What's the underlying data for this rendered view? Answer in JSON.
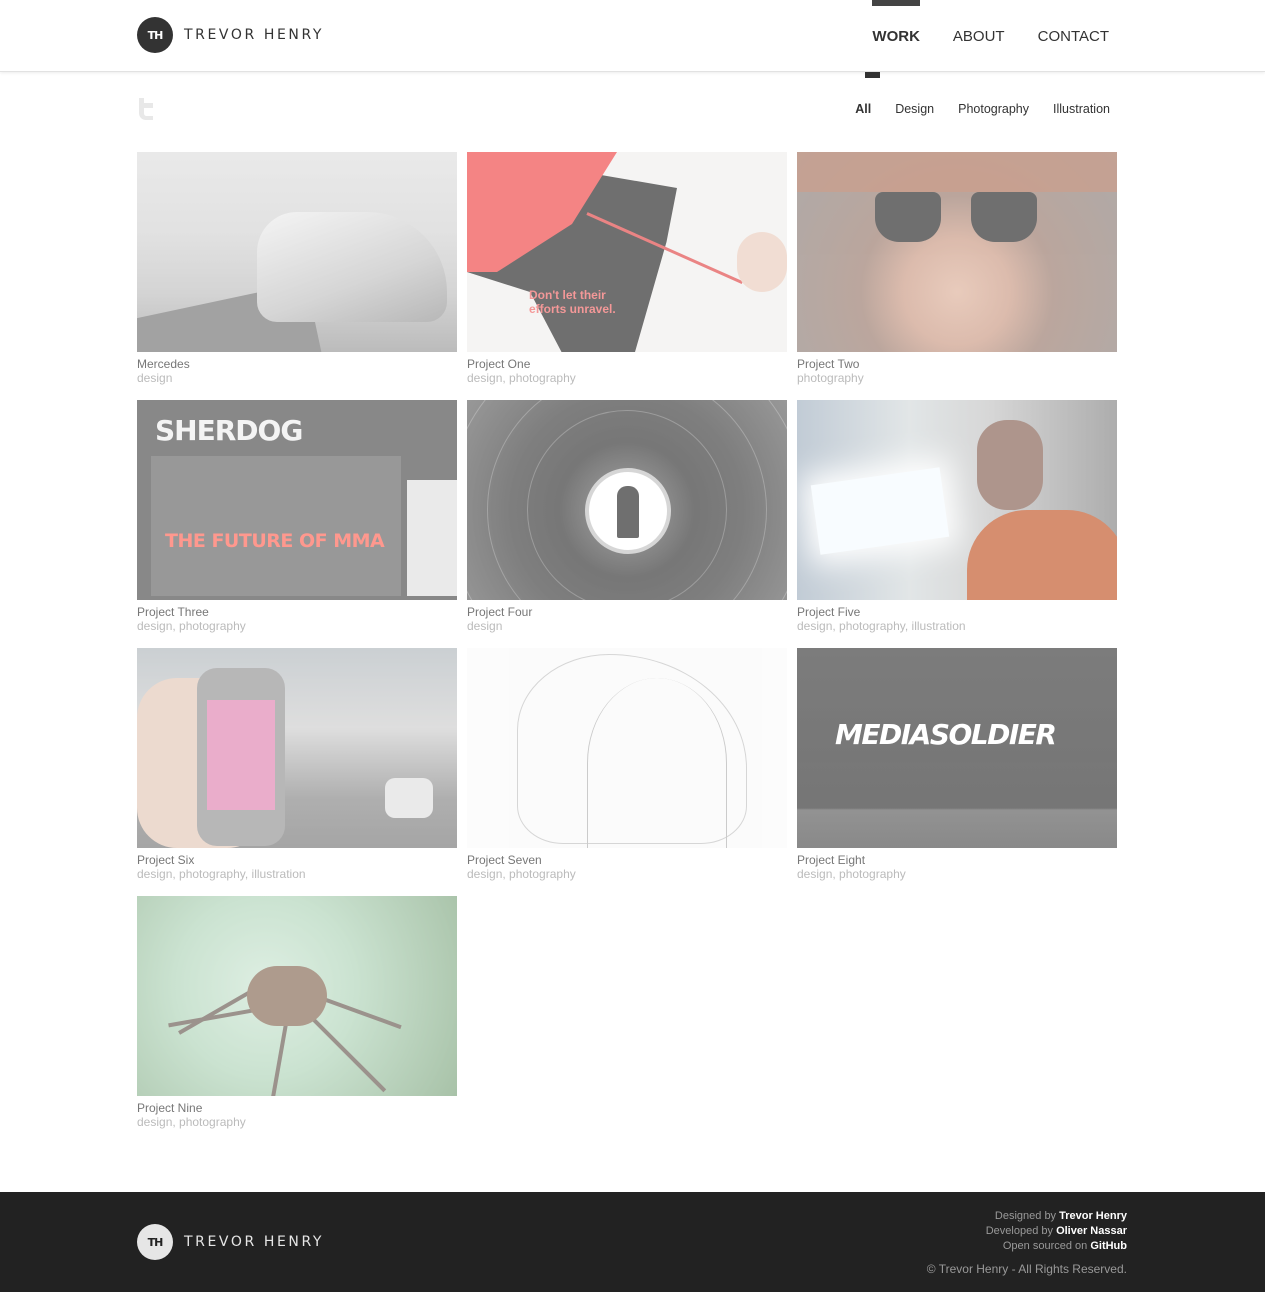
{
  "header": {
    "logo_mark": "TH",
    "logo_text": "TREVOR HENRY",
    "nav": [
      {
        "label": "WORK"
      },
      {
        "label": "ABOUT"
      },
      {
        "label": "CONTACT"
      }
    ]
  },
  "filters": [
    "All",
    "Design",
    "Photography",
    "Illustration"
  ],
  "projects": [
    {
      "title": "Mercedes",
      "tags": "design"
    },
    {
      "title": "Project One",
      "tags": "design, photography"
    },
    {
      "title": "Project Two",
      "tags": "photography"
    },
    {
      "title": "Project Three",
      "tags": "design, photography"
    },
    {
      "title": "Project Four",
      "tags": "design"
    },
    {
      "title": "Project Five",
      "tags": "design, photography, illustration"
    },
    {
      "title": "Project Six",
      "tags": "design, photography, illustration"
    },
    {
      "title": "Project Seven",
      "tags": "design, photography"
    },
    {
      "title": "Project Eight",
      "tags": "design, photography"
    },
    {
      "title": "Project Nine",
      "tags": "design, photography"
    }
  ],
  "thumb_text": {
    "one_slogan_1": "Don't let their",
    "one_slogan_2": "efforts unravel.",
    "three_brand": "SHERDOG",
    "three_headline": "THE FUTURE OF MMA",
    "eight_word": "MEDIASOLDIER"
  },
  "footer": {
    "logo_mark": "TH",
    "logo_text": "TREVOR HENRY",
    "designed_prefix": "Designed by",
    "designed_name": "Trevor Henry",
    "developed_prefix": "Developed by",
    "developed_name": "Oliver Nassar",
    "open_prefix": "Open sourced on",
    "open_name": "GitHub",
    "copyright": "© Trevor Henry - All Rights Reserved."
  },
  "icons": {
    "social": "twitter-icon"
  },
  "colors": {
    "accent": "#333333",
    "footer_bg": "#222222"
  }
}
